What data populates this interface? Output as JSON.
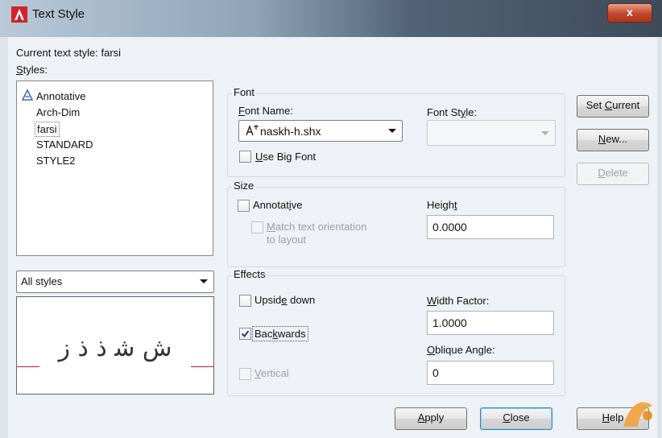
{
  "window": {
    "title": "Text Style",
    "close_label": "x"
  },
  "current_style": "Current text style:  farsi",
  "styles": {
    "label": "Styles:",
    "items": [
      {
        "label": "Annotative",
        "icon": "annotative-icon"
      },
      {
        "label": "Arch-Dim"
      },
      {
        "label": "farsi",
        "selected": true
      },
      {
        "label": "STANDARD"
      },
      {
        "label": "STYLE2"
      }
    ]
  },
  "filter": {
    "value": "All styles"
  },
  "preview": {
    "text": "ش ﺷ ﺫ ﺫ ﺯ"
  },
  "font": {
    "group_label": "Font",
    "name_label": "Font Name:",
    "name_value": "naskh-h.shx",
    "style_label": "Font Style:",
    "style_value": "",
    "bigfont_label": "Use Big Font"
  },
  "size": {
    "group_label": "Size",
    "annotative_label": "Annotative",
    "match_label_1": "Match text orientation",
    "match_label_2": "to layout",
    "height_label": "Height",
    "height_value": "0.0000"
  },
  "effects": {
    "group_label": "Effects",
    "upside_label": "Upside down",
    "backwards_label": "Backwards",
    "backwards_checked": true,
    "vertical_label": "Vertical",
    "width_label": "Width Factor:",
    "width_value": "1.0000",
    "oblique_label": "Oblique Angle:",
    "oblique_value": "0"
  },
  "buttons": {
    "set_current": "Set Current",
    "new": "New...",
    "delete": "Delete",
    "apply": "Apply",
    "close": "Close",
    "help": "Help"
  },
  "colors": {
    "selection": "#3399ff",
    "titlebar_dark": "#3d4a5a",
    "close_red": "#c2452c"
  }
}
